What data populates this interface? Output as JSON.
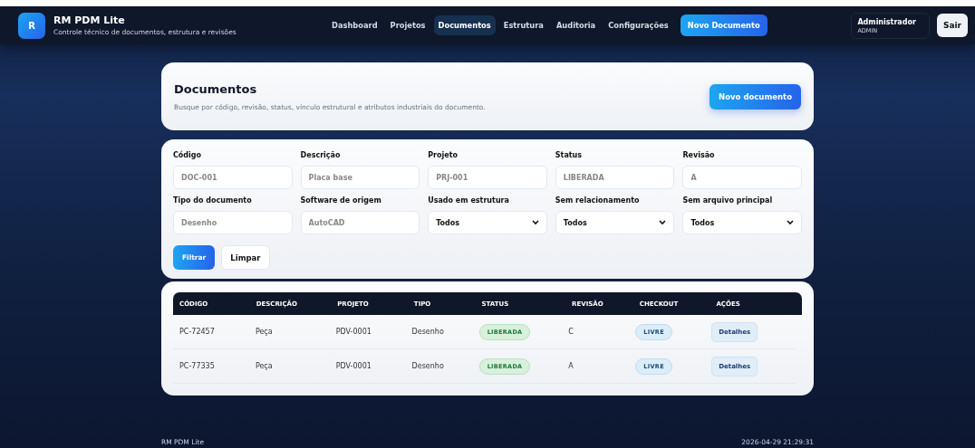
{
  "brand": {
    "logo": "R",
    "title": "RM PDM Lite",
    "subtitle": "Controle técnico de documentos, estrutura e revisões"
  },
  "nav": [
    {
      "label": "Dashboard",
      "kind": "link",
      "selected": false
    },
    {
      "label": "Projetos",
      "kind": "link",
      "selected": false
    },
    {
      "label": "Documentos",
      "kind": "link",
      "selected": true
    },
    {
      "label": "Estrutura",
      "kind": "link",
      "selected": false
    },
    {
      "label": "Auditoria",
      "kind": "link",
      "selected": false
    },
    {
      "label": "Configurações",
      "kind": "link",
      "selected": false
    }
  ],
  "nav_action": "Novo Documento",
  "user": {
    "name": "Administrador",
    "role": "ADMIN",
    "logout": "Sair"
  },
  "header_card": {
    "title": "Documentos",
    "description": "Busque por código, revisão, status, vínculo estrutural e atributos industriais do documento.",
    "button": "Novo documento"
  },
  "filters": [
    {
      "label": "Código",
      "kind": "text",
      "placeholder": "DOC-001"
    },
    {
      "label": "Descrição",
      "kind": "text",
      "placeholder": "Placa base"
    },
    {
      "label": "Projeto",
      "kind": "text",
      "placeholder": "PRJ-001"
    },
    {
      "label": "Status",
      "kind": "text",
      "placeholder": "LIBERADA"
    },
    {
      "label": "Revisão",
      "kind": "text",
      "placeholder": "A"
    },
    {
      "label": "Tipo do documento",
      "kind": "text",
      "placeholder": "Desenho"
    },
    {
      "label": "Software de origem",
      "kind": "text",
      "placeholder": "AutoCAD"
    },
    {
      "label": "Usado em estrutura",
      "kind": "select",
      "value": "Todos"
    },
    {
      "label": "Sem relacionamento",
      "kind": "select",
      "value": "Todos"
    },
    {
      "label": "Sem arquivo principal",
      "kind": "select",
      "value": "Todos"
    }
  ],
  "filter_buttons": {
    "apply": "Filtrar",
    "clear": "Limpar"
  },
  "table": {
    "columns": [
      "CÓDIGO",
      "DESCRIÇÃO",
      "PROJETO",
      "TIPO",
      "STATUS",
      "REVISÃO",
      "CHECKOUT",
      "AÇÕES"
    ],
    "rows": [
      {
        "code": "PC-72457",
        "description": "Peça",
        "project": "PDV-0001",
        "type": "Desenho",
        "status": "LIBERADA",
        "revision": "C",
        "checkout": "LIVRE",
        "action": "Detalhes"
      },
      {
        "code": "PC-77335",
        "description": "Peça",
        "project": "PDV-0001",
        "type": "Desenho",
        "status": "LIBERADA",
        "revision": "A",
        "checkout": "LIVRE",
        "action": "Detalhes"
      }
    ]
  },
  "footer": {
    "app": "RM PDM Lite",
    "timestamp": "2026-04-29 21:29:31"
  }
}
